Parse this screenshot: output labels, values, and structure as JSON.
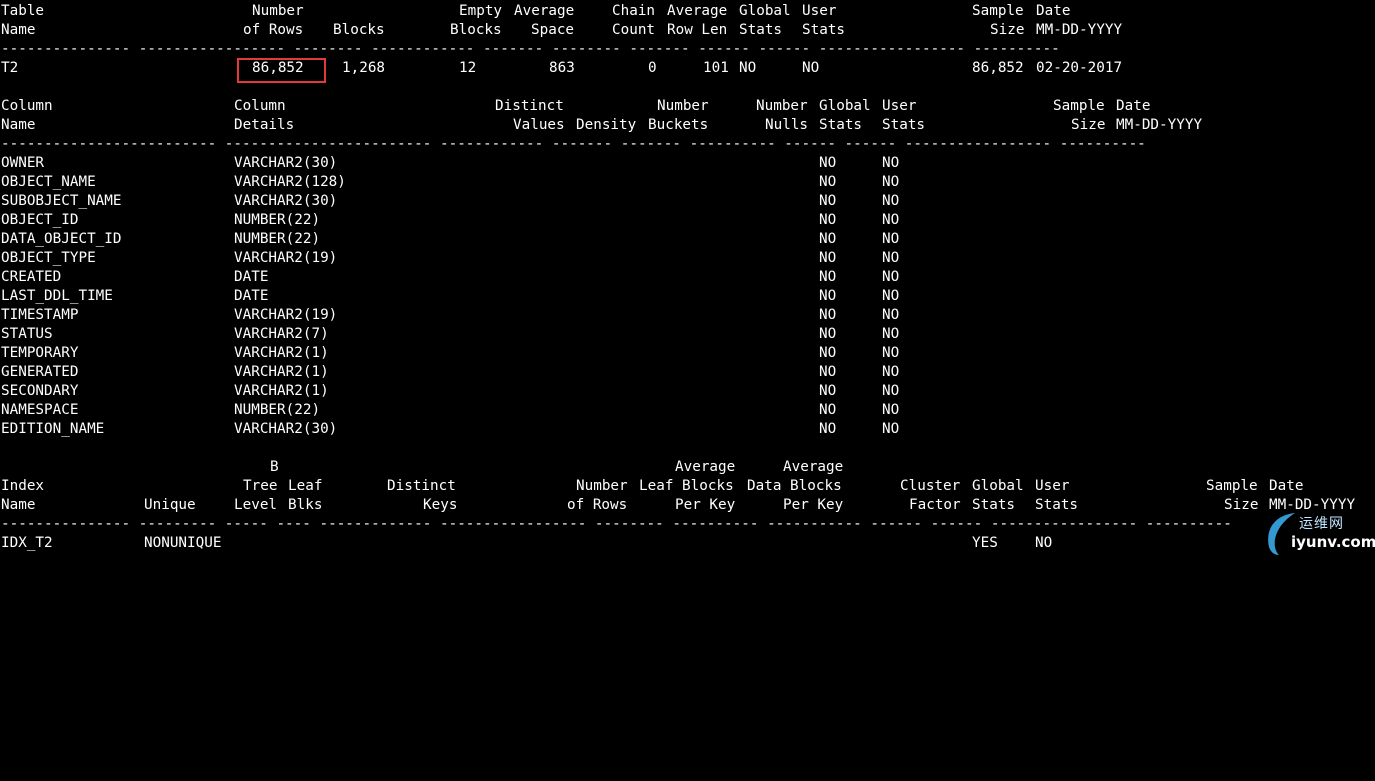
{
  "table_section": {
    "header1": {
      "c1": "Table",
      "c2": "Number",
      "c3": "",
      "c4": "Empty",
      "c5": "Average",
      "c6": "Chain",
      "c7": "Average",
      "c8": "Global",
      "c9": "User",
      "c10": "Sample",
      "c11": "Date"
    },
    "header2": {
      "c1": "Name",
      "c2": "of Rows",
      "c3": "Blocks",
      "c4": "Blocks",
      "c5": "Space",
      "c6": "Count",
      "c7": "Row Len",
      "c8": "Stats",
      "c9": "Stats",
      "c10": "Size",
      "c11": "MM-DD-YYYY"
    },
    "dashes": "--------------- ----------------- -------- ------------ ------- -------- ------- ------ ------ ----------------- ----------",
    "row": {
      "name": "T2",
      "rows": "86,852",
      "blocks": "1,268",
      "empty": "12",
      "avg_space": "863",
      "chain": "0",
      "row_len": "101",
      "global": "NO",
      "user": "NO",
      "sample": "86,852",
      "date": "02-20-2017"
    }
  },
  "column_section": {
    "header1": {
      "c1": "Column",
      "c2": "Column",
      "c3": "Distinct",
      "c4": "",
      "c5": "Number",
      "c6": "Number",
      "c7": "Global",
      "c8": "User",
      "c9": "Sample",
      "c10": "Date"
    },
    "header2": {
      "c1": "Name",
      "c2": "Details",
      "c3": "Values",
      "c4": "Density",
      "c5": "Buckets",
      "c6": "Nulls",
      "c7": "Stats",
      "c8": "Stats",
      "c9": "Size",
      "c10": "MM-DD-YYYY"
    },
    "dashes": "------------------------- ------------------------ ------------ ------- ------- ---------- ------ ------ ----------------- ----------",
    "rows": [
      {
        "name": "OWNER",
        "type": "VARCHAR2(30)",
        "global": "NO",
        "user": "NO"
      },
      {
        "name": "OBJECT_NAME",
        "type": "VARCHAR2(128)",
        "global": "NO",
        "user": "NO"
      },
      {
        "name": "SUBOBJECT_NAME",
        "type": "VARCHAR2(30)",
        "global": "NO",
        "user": "NO"
      },
      {
        "name": "OBJECT_ID",
        "type": "NUMBER(22)",
        "global": "NO",
        "user": "NO"
      },
      {
        "name": "DATA_OBJECT_ID",
        "type": "NUMBER(22)",
        "global": "NO",
        "user": "NO"
      },
      {
        "name": "OBJECT_TYPE",
        "type": "VARCHAR2(19)",
        "global": "NO",
        "user": "NO"
      },
      {
        "name": "CREATED",
        "type": "DATE",
        "global": "NO",
        "user": "NO"
      },
      {
        "name": "LAST_DDL_TIME",
        "type": "DATE",
        "global": "NO",
        "user": "NO"
      },
      {
        "name": "TIMESTAMP",
        "type": "VARCHAR2(19)",
        "global": "NO",
        "user": "NO"
      },
      {
        "name": "STATUS",
        "type": "VARCHAR2(7)",
        "global": "NO",
        "user": "NO"
      },
      {
        "name": "TEMPORARY",
        "type": "VARCHAR2(1)",
        "global": "NO",
        "user": "NO"
      },
      {
        "name": "GENERATED",
        "type": "VARCHAR2(1)",
        "global": "NO",
        "user": "NO"
      },
      {
        "name": "SECONDARY",
        "type": "VARCHAR2(1)",
        "global": "NO",
        "user": "NO"
      },
      {
        "name": "NAMESPACE",
        "type": "NUMBER(22)",
        "global": "NO",
        "user": "NO"
      },
      {
        "name": "EDITION_NAME",
        "type": "VARCHAR2(30)",
        "global": "NO",
        "user": "NO"
      }
    ]
  },
  "index_section": {
    "header0": {
      "btree": "B",
      "avg_leaf": "Average",
      "avg_data": "Average"
    },
    "header1": {
      "c1": "Index",
      "btree": "Tree",
      "leaf": "Leaf",
      "distinct": "Distinct",
      "rows": "Number",
      "avg_leaf": "Leaf Blocks",
      "avg_data": "Data Blocks",
      "cluster": "Cluster",
      "global": "Global",
      "user": "User",
      "sample": "Sample",
      "date": "Date"
    },
    "header2": {
      "c1": "Name",
      "unique": "Unique",
      "btree": "Level",
      "leaf": "Blks",
      "distinct": "Keys",
      "rows": "of Rows",
      "avg_leaf": "Per Key",
      "avg_data": "Per Key",
      "cluster": "Factor",
      "global": "Stats",
      "user": "Stats",
      "sample": "Size",
      "date": "MM-DD-YYYY"
    },
    "dashes": "--------------- --------- ----- ---- ------------- ----------------- -------- ---------- ----------- ------ ------ ----------------- ----------",
    "row": {
      "name": "IDX_T2",
      "unique": "NONUNIQUE",
      "global": "YES",
      "user": "NO"
    }
  },
  "watermark": {
    "top": "运维网",
    "bottom": "iyunv.com"
  },
  "colors": {
    "background": "#000000",
    "text": "#ffffff",
    "highlight": "#e03a3a"
  }
}
